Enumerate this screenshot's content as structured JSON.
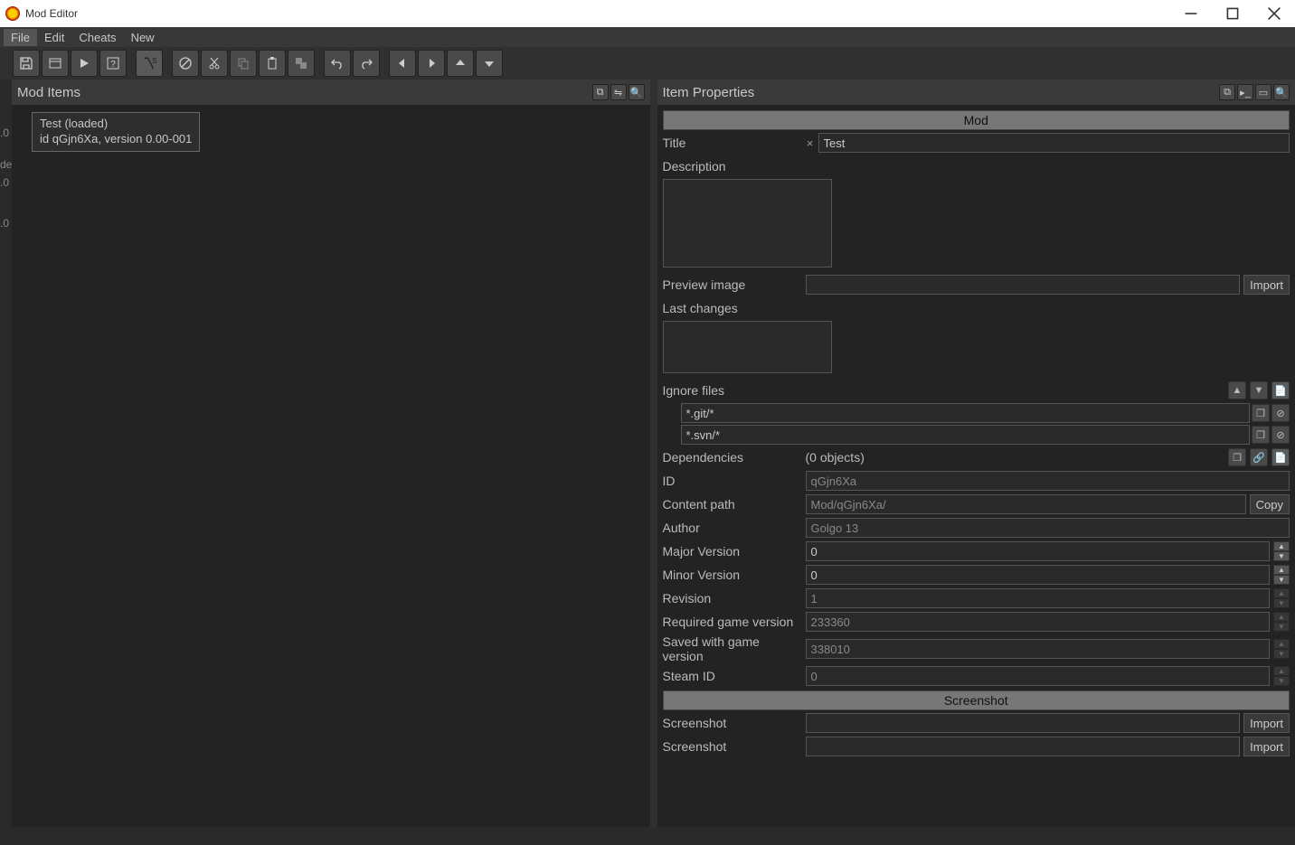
{
  "window": {
    "title": "Mod Editor"
  },
  "menu": {
    "file": "File",
    "edit": "Edit",
    "cheats": "Cheats",
    "new": "New"
  },
  "left_ghost": {
    "a": ".0",
    "b": "de",
    "c": ".0",
    "d": ".0"
  },
  "panels": {
    "mod_items": {
      "title": "Mod Items"
    },
    "item_props": {
      "title": "Item Properties"
    }
  },
  "mod_list": {
    "item": {
      "line1": "Test (loaded)",
      "line2": "id qGjn6Xa, version 0.00-001"
    }
  },
  "sections": {
    "mod": "Mod",
    "screenshot": "Screenshot"
  },
  "labels": {
    "title": "Title",
    "description": "Description",
    "preview_image": "Preview image",
    "last_changes": "Last changes",
    "ignore_files": "Ignore files",
    "dependencies": "Dependencies",
    "deps_count": "(0 objects)",
    "id": "ID",
    "content_path": "Content path",
    "author": "Author",
    "major": "Major Version",
    "minor": "Minor Version",
    "revision": "Revision",
    "req_game": "Required game version",
    "saved_game": "Saved with game version",
    "steam_id": "Steam ID",
    "screenshot": "Screenshot"
  },
  "values": {
    "title": "Test",
    "description": "",
    "preview_image": "",
    "last_changes": "",
    "ignore1": "*.git/*",
    "ignore2": "*.svn/*",
    "id": "qGjn6Xa",
    "content_path": "Mod/qGjn6Xa/",
    "author": "Golgo 13",
    "major": "0",
    "minor": "0",
    "revision": "1",
    "req_game": "233360",
    "saved_game": "338010",
    "steam_id": "0",
    "screenshot1": "",
    "screenshot2": ""
  },
  "buttons": {
    "import": "Import",
    "copy": "Copy"
  },
  "clear_x": "×"
}
